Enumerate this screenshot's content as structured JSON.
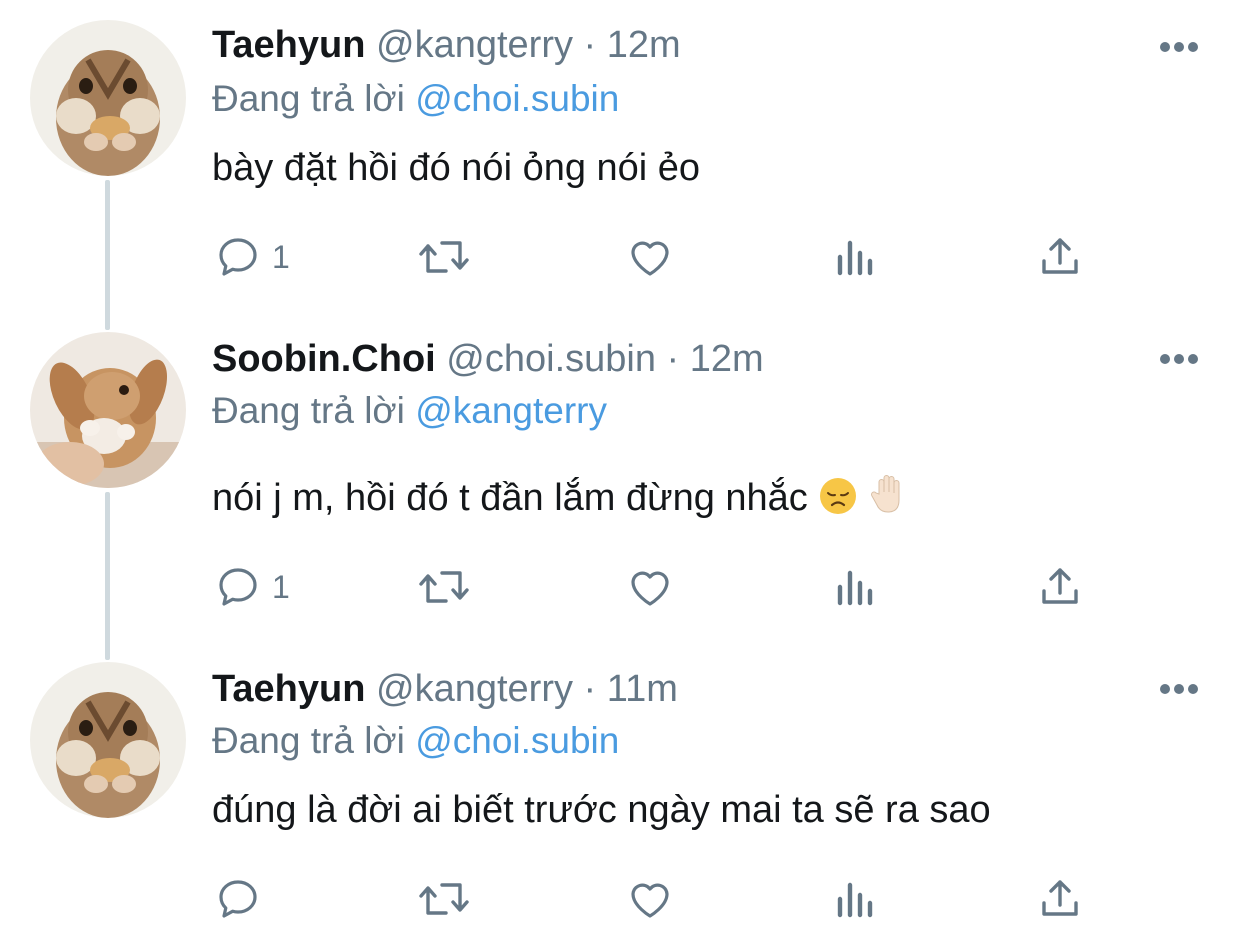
{
  "tweets": [
    {
      "name": "Taehyun",
      "handle": "@kangterry",
      "dot": "·",
      "time": "12m",
      "reply_prefix": "Đang trả lời",
      "reply_to": "@choi.subin",
      "text": "bày đặt hồi đó nói ỏng nói ẻo",
      "reply_count": "1",
      "avatar": "chipmunk-avatar"
    },
    {
      "name": "Soobin.Choi",
      "handle": "@choi.subin",
      "dot": "·",
      "time": "12m",
      "reply_prefix": "Đang trả lời",
      "reply_to": "@kangterry",
      "text": "nói j m, hồi đó t đần lắm đừng nhắc",
      "emojis": [
        "disappointed-face-emoji",
        "raised-hand-emoji"
      ],
      "reply_count": "1",
      "avatar": "bunny-avatar"
    },
    {
      "name": "Taehyun",
      "handle": "@kangterry",
      "dot": "·",
      "time": "11m",
      "reply_prefix": "Đang trả lời",
      "reply_to": "@choi.subin",
      "text": "đúng là đời ai biết trước ngày mai ta sẽ ra sao",
      "reply_count": "",
      "avatar": "chipmunk-avatar"
    }
  ],
  "icons": [
    "reply-icon",
    "retweet-icon",
    "like-icon",
    "analytics-icon",
    "share-icon",
    "more-icon"
  ],
  "colors": {
    "text": "#14171a",
    "secondary": "#657786",
    "mention": "#4a9be0",
    "icon": "#657786",
    "thread_line": "#cfd9de"
  }
}
